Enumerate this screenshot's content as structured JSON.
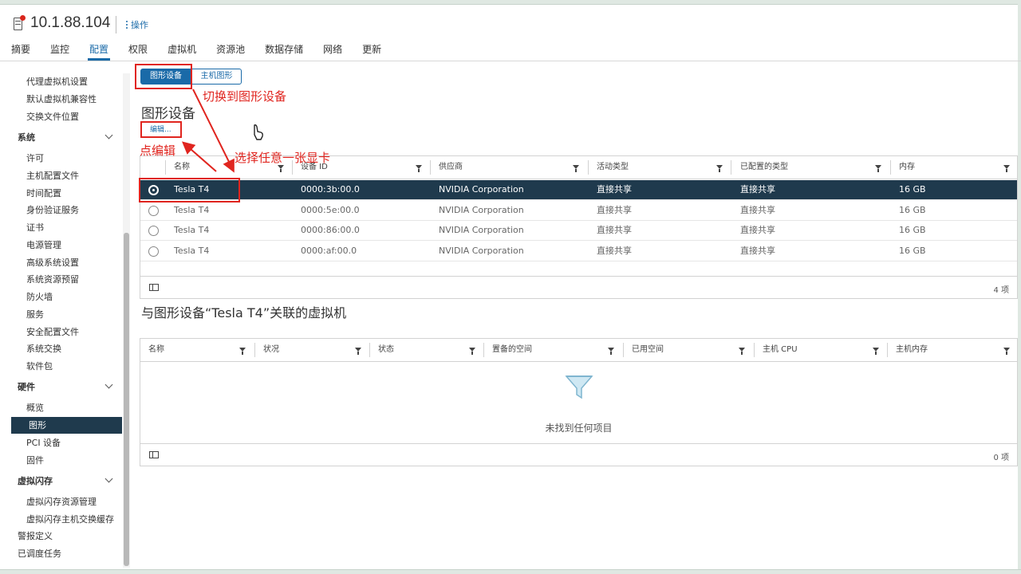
{
  "header": {
    "title": "10.1.88.104",
    "actions_label": "操作"
  },
  "tabs": [
    {
      "label": "摘要"
    },
    {
      "label": "监控"
    },
    {
      "label": "配置"
    },
    {
      "label": "权限"
    },
    {
      "label": "虚拟机"
    },
    {
      "label": "资源池"
    },
    {
      "label": "数据存储"
    },
    {
      "label": "网络"
    },
    {
      "label": "更新"
    }
  ],
  "sidebar": {
    "items_top": [
      "代理虚拟机设置",
      "默认虚拟机兼容性",
      "交换文件位置"
    ],
    "system_label": "系统",
    "system_items": [
      "许可",
      "主机配置文件",
      "时间配置",
      "身份验证服务",
      "证书",
      "电源管理",
      "高级系统设置",
      "系统资源预留",
      "防火墙",
      "服务",
      "安全配置文件",
      "系统交换",
      "软件包"
    ],
    "hardware_label": "硬件",
    "hardware_items": [
      "概览",
      "图形",
      "PCI 设备",
      "固件"
    ],
    "flash_label": "虚拟闪存",
    "flash_items": [
      "虚拟闪存资源管理",
      "虚拟闪存主机交换缓存"
    ],
    "bottom_items": [
      "警报定义",
      "已调度任务"
    ]
  },
  "segment": {
    "graphics_devices": "图形设备",
    "host_graphics": "主机图形"
  },
  "devices": {
    "title": "图形设备",
    "edit_label": "编辑...",
    "columns": [
      "名称",
      "设备 ID",
      "供应商",
      "活动类型",
      "已配置的类型",
      "内存"
    ],
    "rows": [
      {
        "name": "Tesla T4",
        "device_id": "0000:3b:00.0",
        "vendor": "NVIDIA Corporation",
        "active_type": "直接共享",
        "configured_type": "直接共享",
        "memory": "16 GB"
      },
      {
        "name": "Tesla T4",
        "device_id": "0000:5e:00.0",
        "vendor": "NVIDIA Corporation",
        "active_type": "直接共享",
        "configured_type": "直接共享",
        "memory": "16 GB"
      },
      {
        "name": "Tesla T4",
        "device_id": "0000:86:00.0",
        "vendor": "NVIDIA Corporation",
        "active_type": "直接共享",
        "configured_type": "直接共享",
        "memory": "16 GB"
      },
      {
        "name": "Tesla T4",
        "device_id": "0000:af:00.0",
        "vendor": "NVIDIA Corporation",
        "active_type": "直接共享",
        "configured_type": "直接共享",
        "memory": "16 GB"
      }
    ],
    "selected_index": 0,
    "count_label": "4 项"
  },
  "vms": {
    "title": "与图形设备“Tesla T4”关联的虚拟机",
    "columns": [
      "名称",
      "状况",
      "状态",
      "置备的空间",
      "已用空间",
      "主机 CPU",
      "主机内存"
    ],
    "empty_text": "未找到任何项目",
    "count_label": "0 项"
  },
  "annotations": {
    "switch_text": "切换到图形设备",
    "edit_text": "点编辑",
    "select_text": "选择任意一张显卡",
    "color": "#e0251f"
  },
  "colors": {
    "accent": "#1a6aa8",
    "selected_row": "#1f3a4d"
  }
}
